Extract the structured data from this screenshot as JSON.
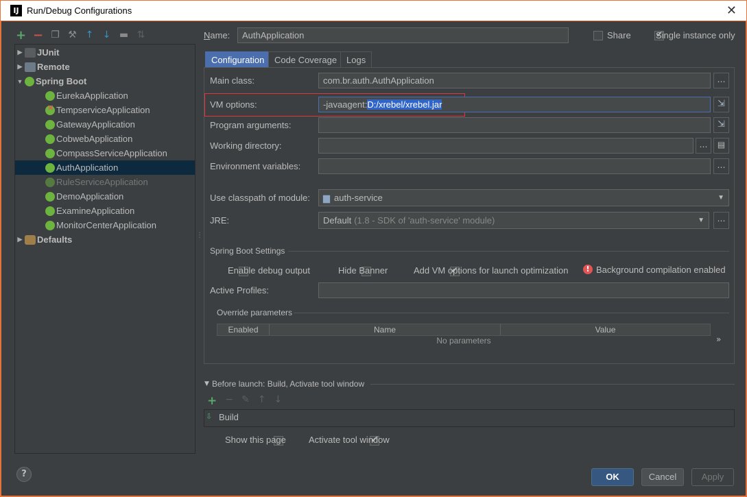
{
  "window": {
    "title": "Run/Debug Configurations",
    "app_icon": "IJ"
  },
  "toolbar": {
    "icons": [
      "plus-icon",
      "minus-icon",
      "copy-icon",
      "wrench-icon",
      "up-arrow-icon",
      "down-arrow-icon",
      "folder-icon",
      "sort-icon"
    ]
  },
  "tree": {
    "junit": "JUnit",
    "remote": "Remote",
    "spring_boot": "Spring Boot",
    "children": [
      "EurekaApplication",
      "TempserviceApplication",
      "GatewayApplication",
      "CobwebApplication",
      "CompassServiceApplication",
      "AuthApplication",
      "RuleServiceApplication",
      "DemoApplication",
      "ExamineApplication",
      "MonitorCenterApplication"
    ],
    "defaults": "Defaults"
  },
  "header": {
    "name_label": "Name:",
    "name_value": "AuthApplication",
    "share_label": "Share",
    "single_instance_label": "Single instance only"
  },
  "tabs": [
    "Configuration",
    "Code Coverage",
    "Logs"
  ],
  "config": {
    "main_class_label": "Main class:",
    "main_class_value": "com.br.auth.AuthApplication",
    "vm_options_label": "VM options:",
    "vm_options_prefix": "-javaagent:",
    "vm_options_selected": "D:/xrebel/xrebel.jar",
    "program_args_label": "Program arguments:",
    "working_dir_label": "Working directory:",
    "env_vars_label": "Environment variables:",
    "classpath_label": "Use classpath of module:",
    "classpath_value": "auth-service",
    "jre_label": "JRE:",
    "jre_value": "Default",
    "jre_hint": "(1.8 - SDK of 'auth-service' module)"
  },
  "spring_boot_settings": {
    "title": "Spring Boot Settings",
    "debug_output": "Enable debug output",
    "hide_banner": "Hide Banner",
    "add_vm_options": "Add VM options for launch optimization",
    "background_compilation": "Background compilation enabled",
    "active_profiles_label": "Active Profiles:",
    "override_title": "Override parameters",
    "columns": [
      "Enabled",
      "Name",
      "Value"
    ],
    "empty_text": "No parameters",
    "more": "»"
  },
  "before_launch": {
    "title": "Before launch: Build, Activate tool window",
    "item": "Build",
    "show_page": "Show this page",
    "activate_tool": "Activate tool window"
  },
  "buttons": {
    "ok": "OK",
    "cancel": "Cancel",
    "apply": "Apply",
    "help": "?"
  },
  "colors": {
    "accent": "#4b6eaf",
    "frame": "#e8733a",
    "highlight_box": "#e0353a",
    "spring": "#6db33f"
  }
}
